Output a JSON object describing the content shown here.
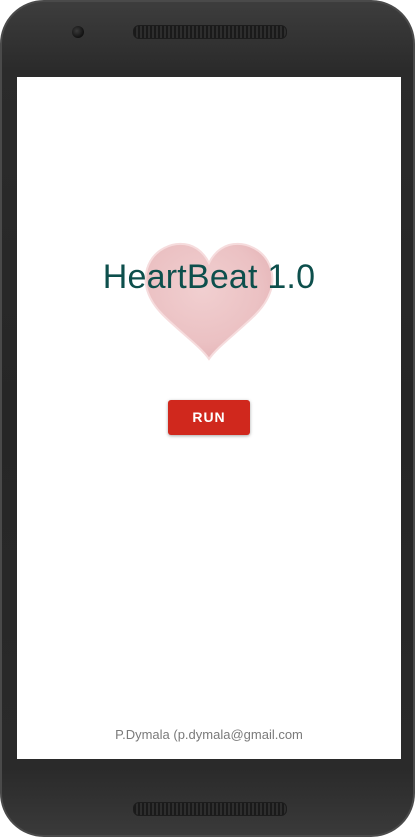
{
  "app": {
    "title": "HeartBeat 1.0",
    "run_label": "RUN",
    "footer": "P.Dymala (p.dymala@gmail.com"
  },
  "colors": {
    "title": "#0d4f4c",
    "run_button": "#d0281d",
    "heart": "#eec4c6",
    "footer": "#7a7a7a"
  },
  "icons": {
    "background_graphic": "heart-icon"
  }
}
